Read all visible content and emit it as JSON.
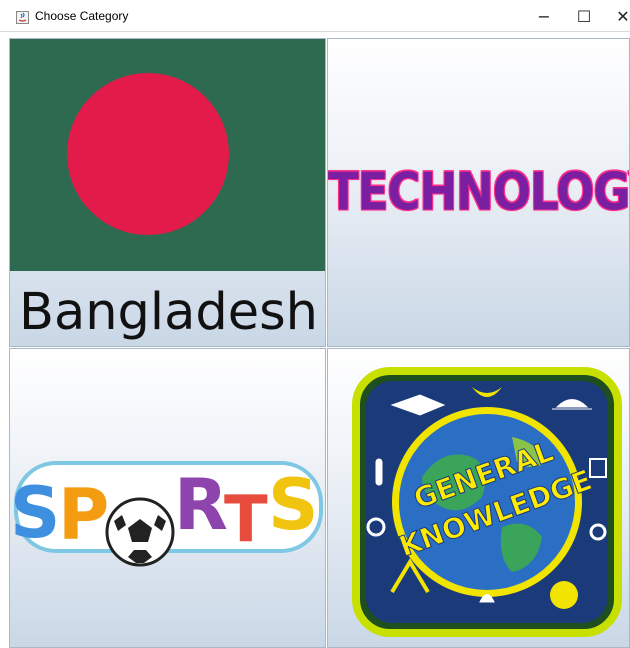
{
  "window": {
    "title": "Choose Category",
    "controls": {
      "minimize": "−",
      "maximize": "☐",
      "close": "✕"
    }
  },
  "categories": [
    {
      "label": "Bangladesh"
    },
    {
      "label": "TECHNOLOGY"
    },
    {
      "label": "SPORTS"
    },
    {
      "label_line1": "GENERAL",
      "label_line2": "KNOWLEDGE"
    }
  ],
  "colors": {
    "flag_green": "#2d6a4f",
    "flag_red": "#e21b4a",
    "tech_text": "#7b1fa2",
    "tech_outline": "#ff2d8a"
  }
}
